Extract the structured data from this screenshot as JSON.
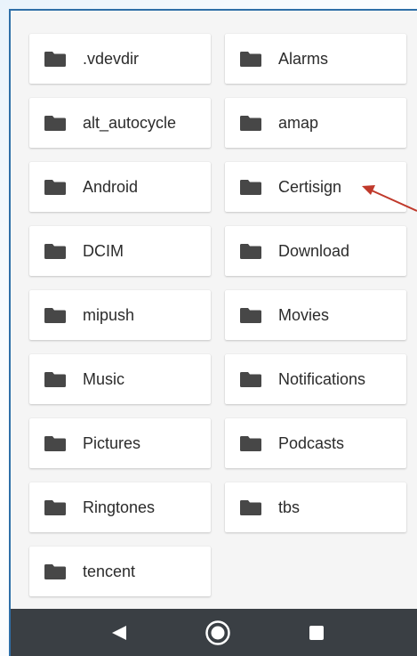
{
  "folders": [
    ".vdevdir",
    "Alarms",
    "alt_autocycle",
    "amap",
    "Android",
    "Certisign",
    "DCIM",
    "Download",
    "mipush",
    "Movies",
    "Music",
    "Notifications",
    "Pictures",
    "Podcasts",
    "Ringtones",
    "tbs",
    "tencent"
  ],
  "icons": {
    "folder": "folder-icon",
    "back": "back-triangle-icon",
    "home": "home-circle-icon",
    "recents": "recents-square-icon"
  },
  "colors": {
    "annotation_arrow": "#c0392b",
    "folder_icon": "#474747",
    "navbar": "#3a3f44",
    "frame_border": "#2e6fa8"
  }
}
